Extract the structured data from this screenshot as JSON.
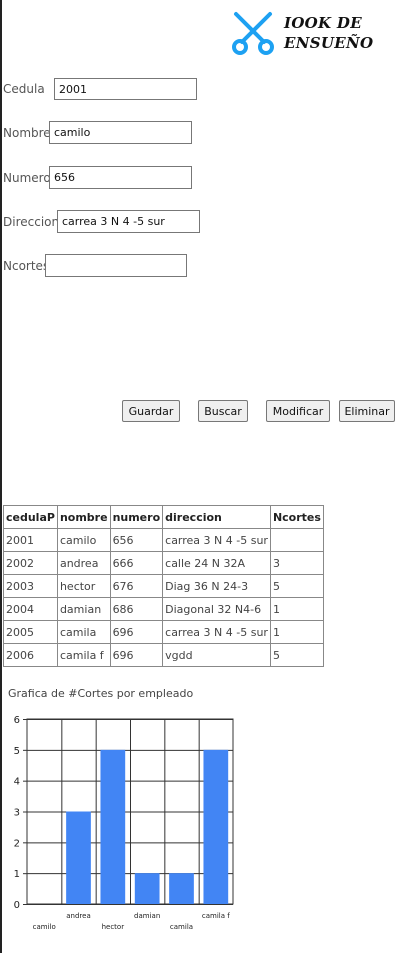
{
  "brand": {
    "line1": "IOOK DE",
    "line2": "ENSUEÑO"
  },
  "form": {
    "cedula_label": "Cedula",
    "cedula_value": "2001",
    "nombre_label": "Nombre",
    "nombre_value": "camilo",
    "numero_label": "Numero",
    "numero_value": "656",
    "direccion_label": "Direccion",
    "direccion_value": "carrea 3 N 4 -5 sur",
    "ncortes_label": "Ncortes",
    "ncortes_value": ""
  },
  "buttons": {
    "guardar": "Guardar",
    "buscar": "Buscar",
    "modificar": "Modificar",
    "eliminar": "Eliminar"
  },
  "table": {
    "headers": [
      "cedulaP",
      "nombre",
      "numero",
      "direccion",
      "Ncortes"
    ],
    "rows": [
      [
        "2001",
        "camilo",
        "656",
        "carrea 3 N 4 -5 sur",
        ""
      ],
      [
        "2002",
        "andrea",
        "666",
        "calle 24 N 32A",
        "3"
      ],
      [
        "2003",
        "hector",
        "676",
        "Diag 36 N 24-3",
        "5"
      ],
      [
        "2004",
        "damian",
        "686",
        "Diagonal 32 N4-6",
        "1"
      ],
      [
        "2005",
        "camila",
        "696",
        "carrea 3 N 4 -5 sur",
        "1"
      ],
      [
        "2006",
        "camila f",
        "696",
        "vgdd",
        "5"
      ]
    ]
  },
  "chart_data": {
    "type": "bar",
    "title": "Grafica de #Cortes por empleado",
    "categories": [
      "camilo",
      "andrea",
      "hector",
      "damian",
      "camila",
      "camila f"
    ],
    "values": [
      0,
      3,
      5,
      1,
      1,
      5
    ],
    "ylim": [
      0,
      6
    ],
    "yticks": [
      "0",
      "1",
      "2",
      "3",
      "4",
      "5",
      "6"
    ],
    "grid": true,
    "color": "#4285f4"
  }
}
